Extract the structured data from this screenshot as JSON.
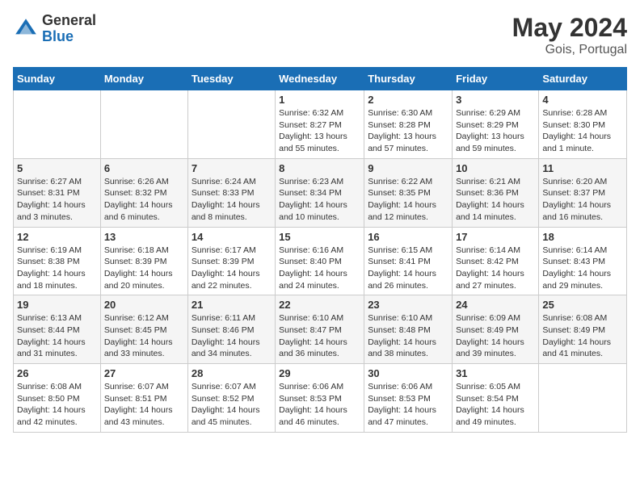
{
  "header": {
    "logo_general": "General",
    "logo_blue": "Blue",
    "month_year": "May 2024",
    "location": "Gois, Portugal"
  },
  "days_of_week": [
    "Sunday",
    "Monday",
    "Tuesday",
    "Wednesday",
    "Thursday",
    "Friday",
    "Saturday"
  ],
  "weeks": [
    [
      {
        "day": "",
        "info": ""
      },
      {
        "day": "",
        "info": ""
      },
      {
        "day": "",
        "info": ""
      },
      {
        "day": "1",
        "info": "Sunrise: 6:32 AM\nSunset: 8:27 PM\nDaylight: 13 hours\nand 55 minutes."
      },
      {
        "day": "2",
        "info": "Sunrise: 6:30 AM\nSunset: 8:28 PM\nDaylight: 13 hours\nand 57 minutes."
      },
      {
        "day": "3",
        "info": "Sunrise: 6:29 AM\nSunset: 8:29 PM\nDaylight: 13 hours\nand 59 minutes."
      },
      {
        "day": "4",
        "info": "Sunrise: 6:28 AM\nSunset: 8:30 PM\nDaylight: 14 hours\nand 1 minute."
      }
    ],
    [
      {
        "day": "5",
        "info": "Sunrise: 6:27 AM\nSunset: 8:31 PM\nDaylight: 14 hours\nand 3 minutes."
      },
      {
        "day": "6",
        "info": "Sunrise: 6:26 AM\nSunset: 8:32 PM\nDaylight: 14 hours\nand 6 minutes."
      },
      {
        "day": "7",
        "info": "Sunrise: 6:24 AM\nSunset: 8:33 PM\nDaylight: 14 hours\nand 8 minutes."
      },
      {
        "day": "8",
        "info": "Sunrise: 6:23 AM\nSunset: 8:34 PM\nDaylight: 14 hours\nand 10 minutes."
      },
      {
        "day": "9",
        "info": "Sunrise: 6:22 AM\nSunset: 8:35 PM\nDaylight: 14 hours\nand 12 minutes."
      },
      {
        "day": "10",
        "info": "Sunrise: 6:21 AM\nSunset: 8:36 PM\nDaylight: 14 hours\nand 14 minutes."
      },
      {
        "day": "11",
        "info": "Sunrise: 6:20 AM\nSunset: 8:37 PM\nDaylight: 14 hours\nand 16 minutes."
      }
    ],
    [
      {
        "day": "12",
        "info": "Sunrise: 6:19 AM\nSunset: 8:38 PM\nDaylight: 14 hours\nand 18 minutes."
      },
      {
        "day": "13",
        "info": "Sunrise: 6:18 AM\nSunset: 8:39 PM\nDaylight: 14 hours\nand 20 minutes."
      },
      {
        "day": "14",
        "info": "Sunrise: 6:17 AM\nSunset: 8:39 PM\nDaylight: 14 hours\nand 22 minutes."
      },
      {
        "day": "15",
        "info": "Sunrise: 6:16 AM\nSunset: 8:40 PM\nDaylight: 14 hours\nand 24 minutes."
      },
      {
        "day": "16",
        "info": "Sunrise: 6:15 AM\nSunset: 8:41 PM\nDaylight: 14 hours\nand 26 minutes."
      },
      {
        "day": "17",
        "info": "Sunrise: 6:14 AM\nSunset: 8:42 PM\nDaylight: 14 hours\nand 27 minutes."
      },
      {
        "day": "18",
        "info": "Sunrise: 6:14 AM\nSunset: 8:43 PM\nDaylight: 14 hours\nand 29 minutes."
      }
    ],
    [
      {
        "day": "19",
        "info": "Sunrise: 6:13 AM\nSunset: 8:44 PM\nDaylight: 14 hours\nand 31 minutes."
      },
      {
        "day": "20",
        "info": "Sunrise: 6:12 AM\nSunset: 8:45 PM\nDaylight: 14 hours\nand 33 minutes."
      },
      {
        "day": "21",
        "info": "Sunrise: 6:11 AM\nSunset: 8:46 PM\nDaylight: 14 hours\nand 34 minutes."
      },
      {
        "day": "22",
        "info": "Sunrise: 6:10 AM\nSunset: 8:47 PM\nDaylight: 14 hours\nand 36 minutes."
      },
      {
        "day": "23",
        "info": "Sunrise: 6:10 AM\nSunset: 8:48 PM\nDaylight: 14 hours\nand 38 minutes."
      },
      {
        "day": "24",
        "info": "Sunrise: 6:09 AM\nSunset: 8:49 PM\nDaylight: 14 hours\nand 39 minutes."
      },
      {
        "day": "25",
        "info": "Sunrise: 6:08 AM\nSunset: 8:49 PM\nDaylight: 14 hours\nand 41 minutes."
      }
    ],
    [
      {
        "day": "26",
        "info": "Sunrise: 6:08 AM\nSunset: 8:50 PM\nDaylight: 14 hours\nand 42 minutes."
      },
      {
        "day": "27",
        "info": "Sunrise: 6:07 AM\nSunset: 8:51 PM\nDaylight: 14 hours\nand 43 minutes."
      },
      {
        "day": "28",
        "info": "Sunrise: 6:07 AM\nSunset: 8:52 PM\nDaylight: 14 hours\nand 45 minutes."
      },
      {
        "day": "29",
        "info": "Sunrise: 6:06 AM\nSunset: 8:53 PM\nDaylight: 14 hours\nand 46 minutes."
      },
      {
        "day": "30",
        "info": "Sunrise: 6:06 AM\nSunset: 8:53 PM\nDaylight: 14 hours\nand 47 minutes."
      },
      {
        "day": "31",
        "info": "Sunrise: 6:05 AM\nSunset: 8:54 PM\nDaylight: 14 hours\nand 49 minutes."
      },
      {
        "day": "",
        "info": ""
      }
    ]
  ]
}
